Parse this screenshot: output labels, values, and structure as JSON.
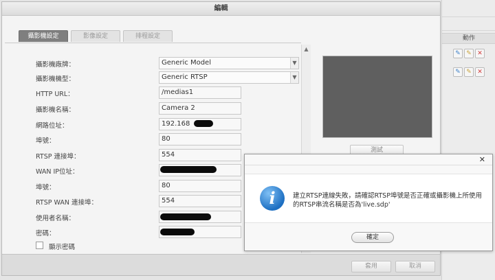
{
  "dialog": {
    "title": "編輯",
    "tabs": [
      {
        "label": "攝影機設定",
        "active": true
      },
      {
        "label": "影像設定",
        "active": false
      },
      {
        "label": "排程設定",
        "active": false
      }
    ]
  },
  "form": {
    "brand": {
      "label": "攝影機廠牌：",
      "value": "Generic Model"
    },
    "model": {
      "label": "攝影機機型：",
      "value": "Generic RTSP"
    },
    "http_url": {
      "label": "HTTP URL：",
      "value": "/medias1"
    },
    "camera_name": {
      "label": "攝影機名稱：",
      "value": "Camera 2"
    },
    "ip": {
      "label": "網路位址：",
      "value": "192.168"
    },
    "port": {
      "label": "埠號：",
      "value": "80"
    },
    "rtsp_port": {
      "label": "RTSP 連接埠：",
      "value": "554"
    },
    "wan_ip": {
      "label": "WAN IP位址：",
      "value": ""
    },
    "wan_port": {
      "label": "埠號：",
      "value": "80"
    },
    "rtsp_wan_port": {
      "label": "RTSP WAN 連接埠：",
      "value": "554"
    },
    "username": {
      "label": "使用者名稱：",
      "value": ""
    },
    "password": {
      "label": "密碼：",
      "value": ""
    },
    "show_password": {
      "label": "顯示密碼",
      "checked": false
    }
  },
  "preview": {
    "test_label": "測試"
  },
  "footer": {
    "apply_label": "套用",
    "cancel_label": "取消"
  },
  "side_panel": {
    "header": "動作"
  },
  "error_dialog": {
    "message": "建立RTSP連線失敗，請確認RTSP埠號是否正確或攝影機上所使用的RTSP串流名稱是否為'live.sdp'",
    "ok_label": "確定",
    "icon": "info-icon"
  }
}
